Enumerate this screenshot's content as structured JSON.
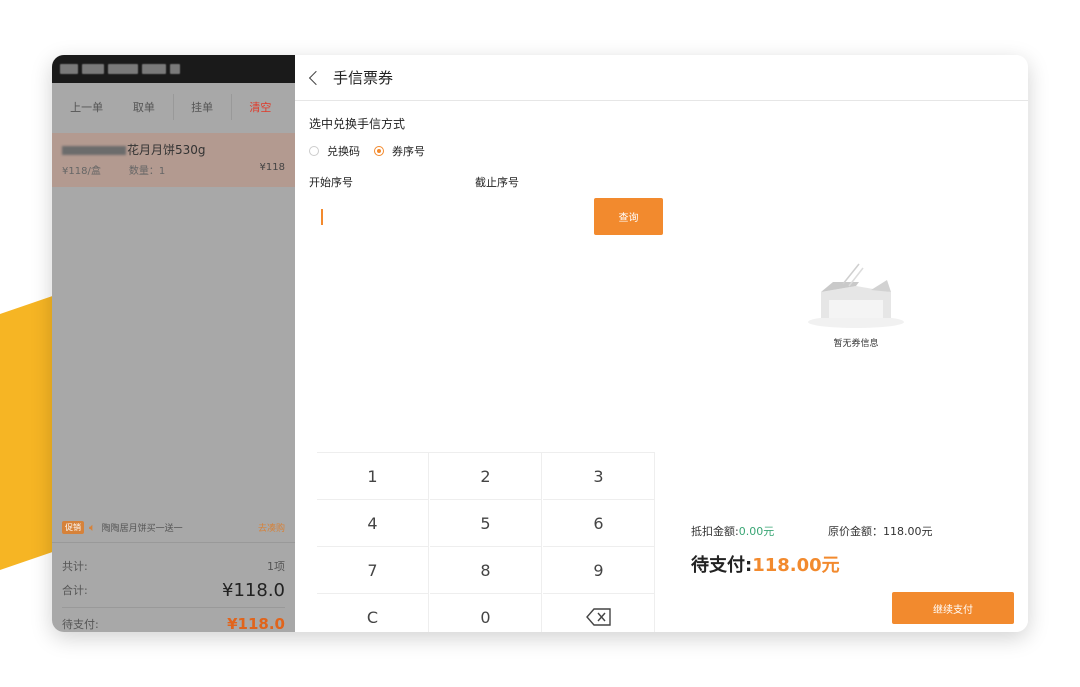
{
  "left_panel": {
    "toolbar": {
      "prev_label": "上一单",
      "take_label": "取单",
      "hold_label": "挂单",
      "clear_label": "清空"
    },
    "cart_item": {
      "name": "花月月饼530g",
      "unit_price": "¥118/盒",
      "qty": "数量：1",
      "amount": "¥118"
    },
    "promo": {
      "tag": "促销",
      "text": "陶陶居月饼买一送一",
      "link": "去凑购"
    },
    "summary": {
      "count_label": "共计:",
      "count_value": "1项",
      "total_label": "合计:",
      "total_value": "¥118.0",
      "due_label": "待支付:",
      "due_value": "¥118.0"
    }
  },
  "right_panel": {
    "title": "手信票券",
    "method_label": "选中兑换手信方式",
    "option_code": "兑换码",
    "option_serial": "券序号",
    "selected_option": "券序号",
    "start_label": "开始序号",
    "end_label": "截止序号",
    "start_value": "",
    "end_value": "",
    "query_label": "查询",
    "empty_text": "暂无券信息",
    "keypad": [
      "1",
      "2",
      "3",
      "4",
      "5",
      "6",
      "7",
      "8",
      "9",
      "C",
      "0"
    ],
    "deduct_label": "抵扣金额:",
    "deduct_value": "0.00元",
    "orig_label": "原价金额：",
    "orig_value": "118.00元",
    "due_label": "待支付:",
    "due_value": "118.00元",
    "pay_label": "继续支付"
  },
  "colors": {
    "accent": "#f28a2e",
    "green": "#3aa675",
    "brand_yellow": "#f6b524"
  }
}
